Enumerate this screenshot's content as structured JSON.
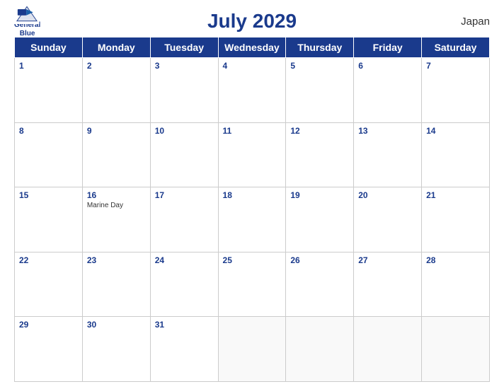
{
  "header": {
    "title": "July 2029",
    "country": "Japan",
    "logo_name": "GeneralBlue",
    "logo_line1": "General",
    "logo_line2": "Blue"
  },
  "days_of_week": [
    "Sunday",
    "Monday",
    "Tuesday",
    "Wednesday",
    "Thursday",
    "Friday",
    "Saturday"
  ],
  "weeks": [
    [
      {
        "day": 1,
        "events": []
      },
      {
        "day": 2,
        "events": []
      },
      {
        "day": 3,
        "events": []
      },
      {
        "day": 4,
        "events": []
      },
      {
        "day": 5,
        "events": []
      },
      {
        "day": 6,
        "events": []
      },
      {
        "day": 7,
        "events": []
      }
    ],
    [
      {
        "day": 8,
        "events": []
      },
      {
        "day": 9,
        "events": []
      },
      {
        "day": 10,
        "events": []
      },
      {
        "day": 11,
        "events": []
      },
      {
        "day": 12,
        "events": []
      },
      {
        "day": 13,
        "events": []
      },
      {
        "day": 14,
        "events": []
      }
    ],
    [
      {
        "day": 15,
        "events": []
      },
      {
        "day": 16,
        "events": [
          "Marine Day"
        ]
      },
      {
        "day": 17,
        "events": []
      },
      {
        "day": 18,
        "events": []
      },
      {
        "day": 19,
        "events": []
      },
      {
        "day": 20,
        "events": []
      },
      {
        "day": 21,
        "events": []
      }
    ],
    [
      {
        "day": 22,
        "events": []
      },
      {
        "day": 23,
        "events": []
      },
      {
        "day": 24,
        "events": []
      },
      {
        "day": 25,
        "events": []
      },
      {
        "day": 26,
        "events": []
      },
      {
        "day": 27,
        "events": []
      },
      {
        "day": 28,
        "events": []
      }
    ],
    [
      {
        "day": 29,
        "events": []
      },
      {
        "day": 30,
        "events": []
      },
      {
        "day": 31,
        "events": []
      },
      {
        "day": null,
        "events": []
      },
      {
        "day": null,
        "events": []
      },
      {
        "day": null,
        "events": []
      },
      {
        "day": null,
        "events": []
      }
    ]
  ],
  "colors": {
    "header_bg": "#1a3a8c",
    "header_text": "#ffffff",
    "title_color": "#1a3a8c",
    "day_num_color": "#1a3a8c"
  }
}
